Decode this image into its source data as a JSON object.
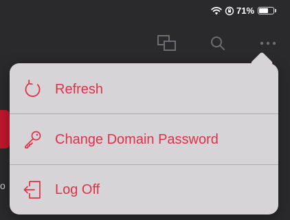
{
  "status_bar": {
    "battery_text": "71%",
    "battery_level": 0.71,
    "icons": [
      "wifi-icon",
      "orientation-lock-icon",
      "battery-icon"
    ]
  },
  "toolbar": {
    "icons": [
      "windows-icon",
      "search-icon",
      "more-icon"
    ]
  },
  "menu": {
    "items": [
      {
        "label": "Refresh",
        "icon": "refresh-icon"
      },
      {
        "label": "Change Domain Password",
        "icon": "key-icon"
      },
      {
        "label": "Log Off",
        "icon": "log-off-icon"
      }
    ]
  },
  "background": {
    "partial_text": "o"
  },
  "colors": {
    "accent": "#e0304a",
    "menu_bg": "#d6d4d6",
    "background": "#2a2a2c",
    "toolbar_icon": "#6e6e72"
  }
}
